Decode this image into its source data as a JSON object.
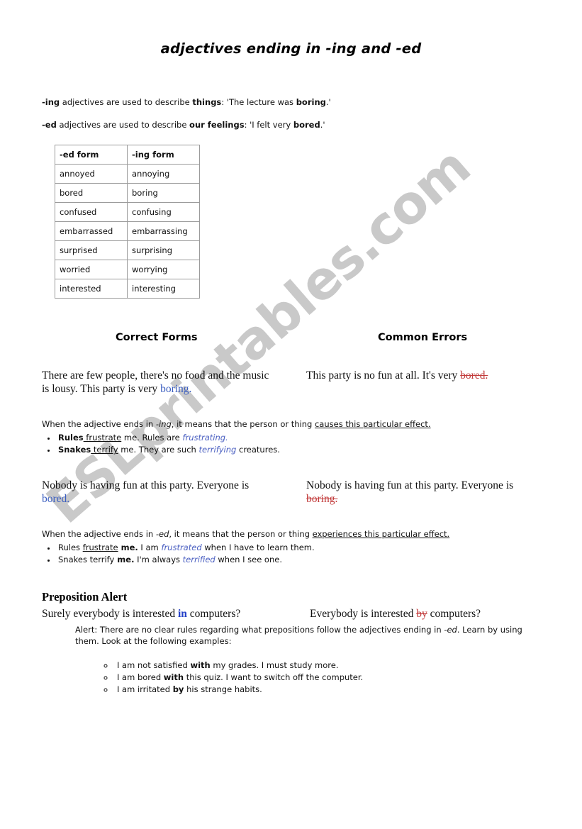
{
  "watermark": {
    "text": "ESLprintables.com"
  },
  "title": {
    "pre": "adjectives ending in ",
    "ing": "-ing",
    "mid": " and ",
    "ed": "-ed"
  },
  "intro": {
    "line1": {
      "lead": "-ing",
      "mid": " adjectives are used to describe ",
      "bold": "things",
      "tail": ": 'The lecture was ",
      "bold2": "boring",
      "end": ".'"
    },
    "line2": {
      "lead": "-ed",
      "mid": " adjectives are used to describe ",
      "bold": "our feelings",
      "tail": ": 'I felt very ",
      "bold2": "bored",
      "end": ".'"
    }
  },
  "table": {
    "headers": [
      "-ed form",
      "-ing form"
    ],
    "rows": [
      [
        "annoyed",
        "annoying"
      ],
      [
        "bored",
        "boring"
      ],
      [
        "confused",
        "confusing"
      ],
      [
        "embarrassed",
        "embarrassing"
      ],
      [
        "surprised",
        "surprising"
      ],
      [
        "worried",
        "worrying"
      ],
      [
        "interested",
        "interesting"
      ]
    ]
  },
  "columns": {
    "correct": "Correct Forms",
    "errors": "Common Errors"
  },
  "example1": {
    "left_text": "There are few people, there's no food and the music is lousy. This party is very ",
    "left_highlight": "boring.",
    "right_text": "This party is no fun at all. It's very ",
    "right_error": "bored."
  },
  "rule_ing": {
    "lead_a": "When the adjective ends in ",
    "lead_italic": "-ing",
    "lead_b": ", it means that the person or thing ",
    "lead_underline": "causes this particular effect.",
    "bullets": [
      {
        "bold": "Rules",
        "underline": " frustrate",
        "mid": " me. Rules are ",
        "italic": "frustrating.",
        "tail": ""
      },
      {
        "bold": "Snakes",
        "underline": " terrify",
        "mid": " me. They are such ",
        "italic": "terrifying",
        "tail": " creatures."
      }
    ]
  },
  "example2": {
    "left_text": "Nobody is having fun at this party. Everyone is ",
    "left_highlight": "bored.",
    "right_text": "Nobody is having fun at this party. Everyone is ",
    "right_error": "boring."
  },
  "rule_ed": {
    "lead_a": "When the adjective ends in ",
    "lead_italic": "-ed",
    "lead_b": ", it means that the person or thing ",
    "lead_underline": "experiences this particular effect.",
    "bullets": [
      {
        "plain": "Rules ",
        "underline": "frustrate",
        "bold": " me.",
        "mid": " I am ",
        "italic": "frustrated",
        "tail": " when I have to learn them."
      },
      {
        "plain": "Snakes terrify",
        "underline": "",
        "bold": " me.",
        "mid": " I'm always ",
        "italic": "terrified",
        "tail": " when I see one."
      }
    ]
  },
  "preposition": {
    "title": "Preposition Alert",
    "left_a": "Surely everybody is interested ",
    "left_prep": "in",
    "left_b": " computers?",
    "right_a": "Everybody is interested ",
    "right_prep": "by",
    "right_b": " computers?",
    "note_a": "Alert: There are no clear rules regarding what prepositions follow the adjectives ending in ",
    "note_italic": "-ed",
    "note_b": ". Learn by using them. Look at the following examples:",
    "examples": [
      {
        "a": "I am not satisfied ",
        "prep": "with",
        "b": " my grades. I must study more."
      },
      {
        "a": "I am bored ",
        "prep": "with",
        "b": " this quiz. I want to switch off the computer."
      },
      {
        "a": "I am irritated ",
        "prep": "by",
        "b": " his strange habits."
      }
    ]
  },
  "colors": {
    "blue": "#3b5ec0",
    "red": "#c23b3b",
    "watermark_gray": "#c9c9c9"
  }
}
